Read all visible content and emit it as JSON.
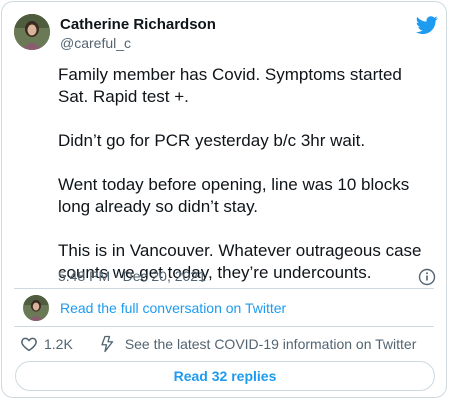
{
  "author": {
    "name": "Catherine Richardson",
    "handle": "@careful_c",
    "avatar_color": "#5b6b4a"
  },
  "brand": {
    "icon": "twitter-bird-icon",
    "color": "#1d9bf0"
  },
  "tweet": {
    "paragraphs": [
      "Family member has Covid. Symptoms started\nSat. Rapid test +.",
      "Didn’t go for PCR yesterday b/c 3hr wait.",
      "Went today before opening, line was 10 blocks\nlong already so didn’t stay.",
      "This is in Vancouver. Whatever outrageous case\ncounts we get today, they’re undercounts."
    ],
    "timestamp": "5:48 PM · Dec 20, 2021"
  },
  "conversation_link": "Read the full conversation on Twitter",
  "actions": {
    "likes": "1.2K",
    "covid_info": "See the latest COVID-19 information on Twitter"
  },
  "read_replies": "Read 32 replies"
}
